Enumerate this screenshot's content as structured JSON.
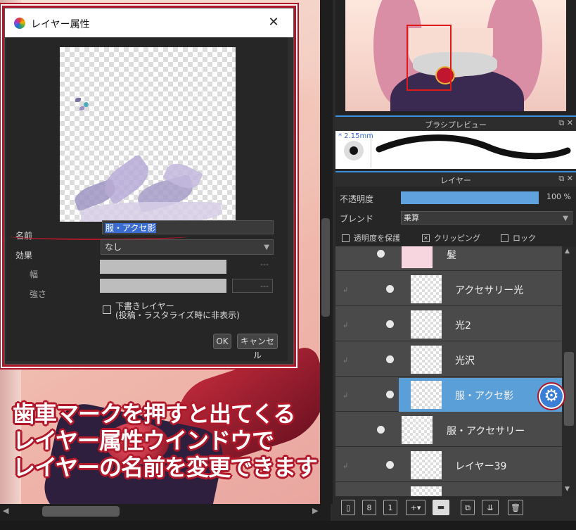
{
  "dialog": {
    "title": "レイヤー属性",
    "name_label": "名前",
    "name_value": "服・アクセ影",
    "effect_label": "効果",
    "effect_value": "なし",
    "width_label": "幅",
    "width_value": "---",
    "strength_label": "強さ",
    "strength_value": "---",
    "draft_label_line1": "下書きレイヤー",
    "draft_label_line2": "(投稿・ラスタライズ時に非表示)",
    "draft_checked": false,
    "ok_label": "OK",
    "cancel_label": "キャンセル"
  },
  "brush_preview": {
    "title": "ブラシプレビュー",
    "size_text": "* 2.15mm"
  },
  "layer_panel": {
    "title": "レイヤー",
    "opacity_label": "不透明度",
    "opacity_value": "100 %",
    "opacity_percent": 100,
    "blend_label": "ブレンド",
    "blend_value": "乗算",
    "protect_alpha_label": "透明度を保護",
    "protect_alpha_checked": false,
    "clipping_label": "クリッピング",
    "clipping_checked": true,
    "lock_label": "ロック",
    "lock_checked": false,
    "layers": [
      {
        "name": "髪",
        "clipped": false,
        "selected": false
      },
      {
        "name": "アクセサリー光",
        "clipped": true,
        "selected": false
      },
      {
        "name": "光2",
        "clipped": true,
        "selected": false
      },
      {
        "name": "光沢",
        "clipped": true,
        "selected": false
      },
      {
        "name": "服・アクセ影",
        "clipped": true,
        "selected": true
      },
      {
        "name": "服・アクセサリー",
        "clipped": false,
        "selected": false
      },
      {
        "name": "レイヤー39",
        "clipped": true,
        "selected": false
      }
    ]
  },
  "toolbar_icons": [
    "new-layer-icon",
    "new-8bit-layer-icon",
    "new-1bit-layer-icon",
    "add-special-layer-icon",
    "new-folder-icon",
    "duplicate-layer-icon",
    "merge-down-icon",
    "delete-layer-icon"
  ],
  "annotation": {
    "line1": "歯車マークを押すと出てくる",
    "line2": "レイヤー属性ウインドウで",
    "line3": "レイヤーの名前を変更できます"
  },
  "colors": {
    "accent_red": "#b0182a",
    "selected_layer": "#5a9fd8",
    "gear_button": "#3a7fd5"
  }
}
